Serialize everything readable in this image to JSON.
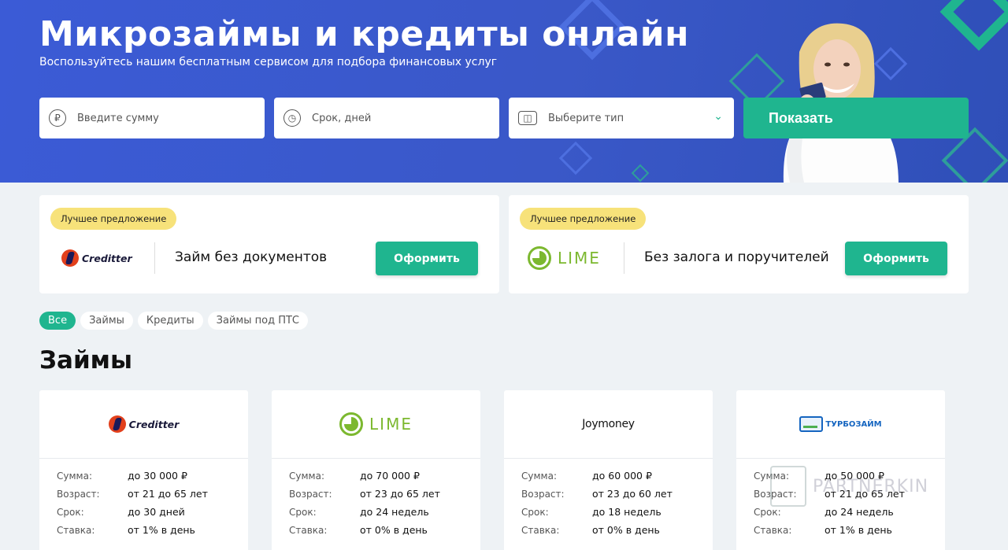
{
  "hero": {
    "title": "Микрозаймы и кредиты онлайн",
    "subtitle": "Воспользуйтесь нашим бесплатным сервисом для подбора финансовых услуг",
    "amount_placeholder": "Введите сумму",
    "term_placeholder": "Срок, дней",
    "type_placeholder": "Выберите тип",
    "show_button": "Показать",
    "currency_symbol": "₽"
  },
  "offers": [
    {
      "badge": "Лучшее предложение",
      "brand": "Creditter",
      "title": "Займ без документов",
      "button": "Оформить"
    },
    {
      "badge": "Лучшее предложение",
      "brand": "LIME",
      "title": "Без залога и поручителей",
      "button": "Оформить"
    }
  ],
  "filters": [
    "Все",
    "Займы",
    "Кредиты",
    "Займы под ПТС"
  ],
  "section_title": "Займы",
  "labels": {
    "sum": "Сумма:",
    "age": "Возраст:",
    "term": "Срок:",
    "rate": "Ставка:"
  },
  "loans": [
    {
      "brand": "Creditter",
      "sum": "до 30 000 ₽",
      "age": " от 21 до 65 лет",
      "term": "до 30 дней",
      "rate": "от 1% в день"
    },
    {
      "brand": "LIME",
      "sum": "до 70 000 ₽",
      "age": " от 23 до 65 лет",
      "term": "до 24 недель",
      "rate": "от 0% в день"
    },
    {
      "brand": "Joymoney",
      "sum": "до 60 000 ₽",
      "age": " от 23 до 60 лет",
      "term": "до 18 недель",
      "rate": "от 0% в день"
    },
    {
      "brand": "ТУРБОЗАЙМ",
      "sum": "до 50 000 ₽",
      "age": " от 21 до 65 лет",
      "term": "до 24 недель",
      "rate": "от 1% в день"
    }
  ],
  "watermark": "PARTNERKIN",
  "colors": {
    "hero_blue": "#3b5bd6",
    "accent_green": "#1fb58f",
    "badge_yellow": "#f7e27a"
  }
}
